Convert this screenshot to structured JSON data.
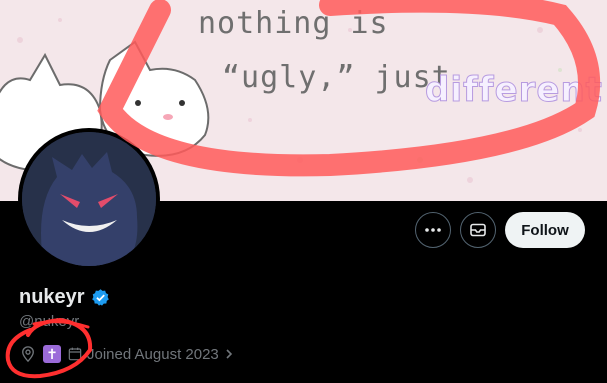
{
  "banner": {
    "line1": "nothing is",
    "line2": "“ugly,” just",
    "line3": "different"
  },
  "profile": {
    "display_name": "nukeyr",
    "handle": "@nukeyr",
    "joined": "Joined August 2023",
    "bio_emoji": "✝",
    "follow_label": "Follow"
  },
  "icons": {
    "more": "more-dots-icon",
    "message": "mail-icon",
    "location": "location-pin-icon",
    "calendar": "calendar-icon",
    "verified": "verified-badge-icon"
  },
  "colors": {
    "background": "#000000",
    "follow_bg": "#eff3f4",
    "verified": "#1d9bf0",
    "annotation": "#ff4d4d"
  }
}
